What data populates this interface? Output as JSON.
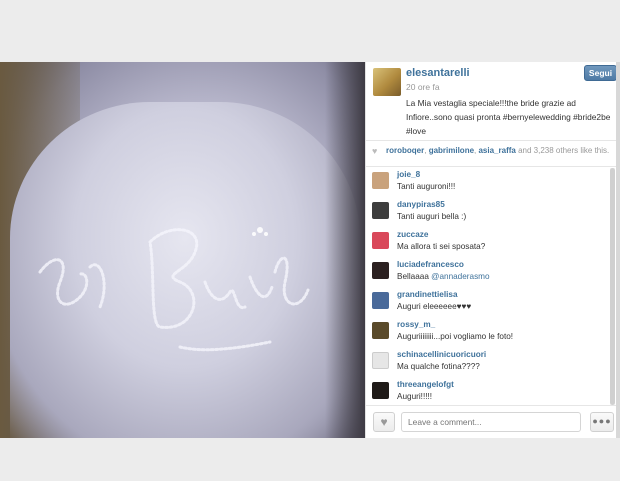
{
  "post": {
    "username": "elesantarelli",
    "time": "20 ore fa",
    "follow_label": "Segui",
    "caption": "La Mia vestaglia speciale!!!the bride grazie ad Infiore..sono quasi pronta #bernyelewedding #bride2be #love"
  },
  "likes": {
    "names": [
      "roroboqer",
      "gabrimilone",
      "asia_raffa"
    ],
    "suffix": "and 3,238 others like this."
  },
  "comments": [
    {
      "user": "joie_8",
      "text": "Tanti auguroni!!!",
      "avatar_color": "#c9a27c"
    },
    {
      "user": "danypiras85",
      "text": "Tanti auguri bella :)",
      "avatar_color": "#3d3d3d"
    },
    {
      "user": "zuccaze",
      "text": "Ma allora ti sei sposata?",
      "avatar_color": "#d9485a"
    },
    {
      "user": "luciadefrancesco",
      "text": "Bellaaaa ",
      "mention": "@annaderasmo",
      "avatar_color": "#2b2020"
    },
    {
      "user": "grandinettielisa",
      "text": "Auguri eleeeeee♥♥♥",
      "avatar_color": "#4a6a9a"
    },
    {
      "user": "rossy_m_",
      "text": "Auguriiiiiiii...poi vogliamo le foto!",
      "avatar_color": "#5a4a2a"
    },
    {
      "user": "schinacellinicuoricuori",
      "text": "Ma qualche fotina????",
      "avatar_color": "#e6e6e6"
    },
    {
      "user": "threeangelofgt",
      "text": "Auguri!!!!!",
      "avatar_color": "#1f1a18"
    }
  ],
  "footer": {
    "comment_placeholder": "Leave a comment...",
    "heart_icon": "heart-icon",
    "more_icon": "ellipsis-icon"
  },
  "photo": {
    "script_text": "the Bride"
  }
}
